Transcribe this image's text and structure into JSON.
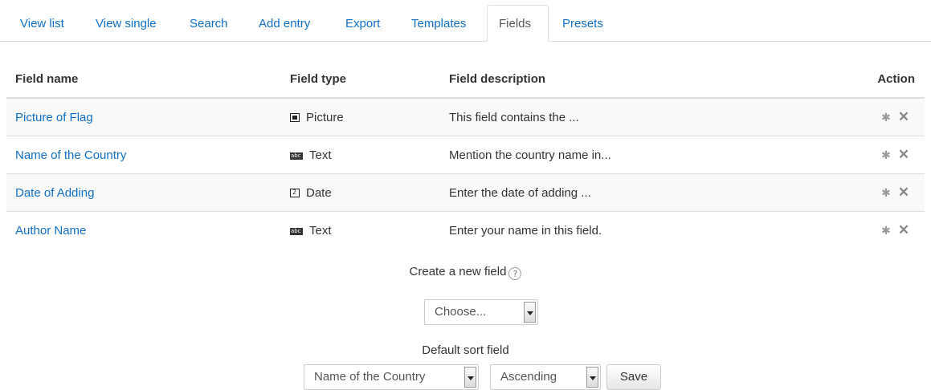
{
  "tabs": [
    {
      "label": "View list"
    },
    {
      "label": "View single"
    },
    {
      "label": "Search"
    },
    {
      "label": "Add entry"
    },
    {
      "label": "Export"
    },
    {
      "label": "Templates"
    },
    {
      "label": "Fields",
      "active": true
    },
    {
      "label": "Presets"
    }
  ],
  "table": {
    "headers": {
      "name": "Field name",
      "type": "Field type",
      "description": "Field description",
      "action": "Action"
    },
    "rows": [
      {
        "name": "Picture of Flag",
        "type": "Picture",
        "type_icon": "picture-icon",
        "description": "This field contains the ..."
      },
      {
        "name": "Name of the Country",
        "type": "Text",
        "type_icon": "text-icon",
        "description": "Mention the country name in..."
      },
      {
        "name": "Date of Adding",
        "type": "Date",
        "type_icon": "date-icon",
        "description": "Enter the date of adding ..."
      },
      {
        "name": "Author Name",
        "type": "Text",
        "type_icon": "text-icon",
        "description": "Enter your name in this field."
      }
    ],
    "action_icons": [
      "gear-icon",
      "close-icon"
    ]
  },
  "create_field": {
    "label": "Create a new field",
    "help_icon": "question-mark-icon",
    "help_glyph": "?",
    "select_value": "Choose..."
  },
  "default_sort": {
    "label": "Default sort field",
    "field_value": "Name of the Country",
    "order_value": "Ascending",
    "save_label": "Save"
  },
  "colors": {
    "link": "#0f6fc5",
    "text": "#333333",
    "border": "#dddddd",
    "row_stripe": "#f9f9f9"
  }
}
